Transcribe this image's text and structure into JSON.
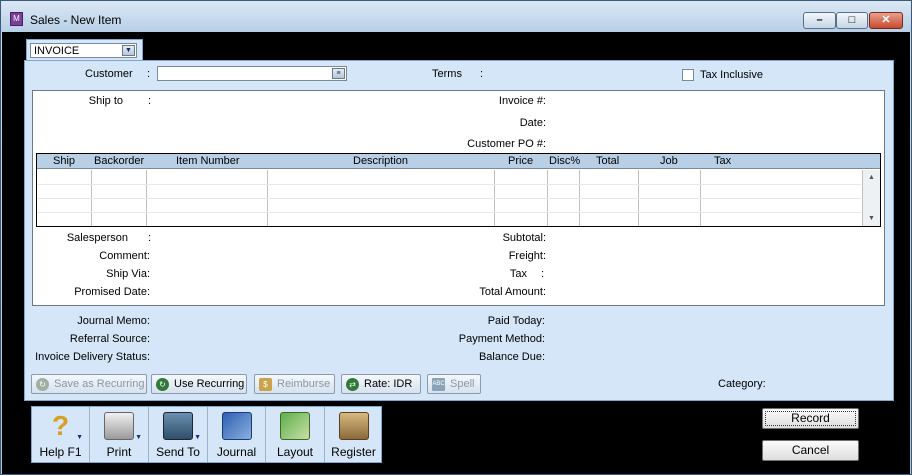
{
  "window": {
    "title": "Sales - New Item",
    "min": "–",
    "max": "□",
    "close": "✕"
  },
  "tab": {
    "selected": "INVOICE"
  },
  "header": {
    "customer_label": "Customer",
    "colon": ":",
    "terms_label": "Terms",
    "tax_inclusive_label": "Tax Inclusive"
  },
  "details": {
    "ship_to_label": "Ship to",
    "invoice_no_label": "Invoice #:",
    "date_label": "Date:",
    "customer_po_label": "Customer PO #:"
  },
  "grid": {
    "columns": [
      "Ship",
      "Backorder",
      "Item Number",
      "Description",
      "Price",
      "Disc%",
      "Total",
      "Job",
      "Tax"
    ]
  },
  "footer": {
    "salesperson_label": "Salesperson",
    "comment_label": "Comment:",
    "ship_via_label": "Ship Via:",
    "promised_date_label": "Promised Date:",
    "subtotal_label": "Subtotal:",
    "freight_label": "Freight:",
    "tax_label": "Tax",
    "total_amount_label": "Total Amount:"
  },
  "memo": {
    "journal_memo_label": "Journal Memo:",
    "referral_source_label": "Referral Source:",
    "delivery_status_label": "Invoice Delivery Status:",
    "paid_today_label": "Paid Today:",
    "payment_method_label": "Payment Method:",
    "balance_due_label": "Balance Due:"
  },
  "actions": {
    "save_recurring": "Save as Recurring",
    "use_recurring": "Use Recurring",
    "reimburse": "Reimburse",
    "rate": "Rate:  IDR",
    "spell": "Spell",
    "category_label": "Category:"
  },
  "toolbar": {
    "help": "Help F1",
    "print": "Print",
    "send_to": "Send To",
    "journal": "Journal",
    "layout": "Layout",
    "register": "Register"
  },
  "buttons": {
    "record": "Record",
    "cancel": "Cancel"
  }
}
